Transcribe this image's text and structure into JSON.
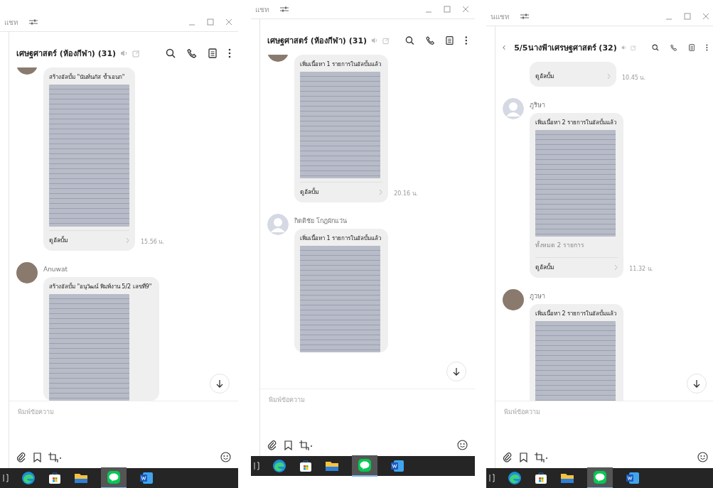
{
  "panels": [
    {
      "top_label": "แชท",
      "back_button": false,
      "title": "เศษฐศาสตร์ (ห้องกีฬา) (31)",
      "messages": [
        {
          "kind": "album",
          "avatar": {
            "kind": "photo"
          },
          "caption": "สร้างอัลบั้ม \"นันท์นภัส ข้ำเอนก\"",
          "link": "ดูอัลบั้ม",
          "time": "15.56 น."
        },
        {
          "kind": "album",
          "sender": "Anuwat",
          "avatar": {
            "kind": "photo"
          },
          "caption": "สร้างอัลบั้ม \"อนุวัฒน์ พิมพ์งาน 5/2 เลขที่9\""
        }
      ],
      "placeholder": "พิมพ์ข้อความ"
    },
    {
      "top_label": "แชท",
      "back_button": false,
      "title": "เศษฐศาสตร์ (ห้องกีฬา) (31)",
      "messages": [
        {
          "kind": "album",
          "avatar": {
            "kind": "photo"
          },
          "caption": "เพิ่มเนื้อหา 1 รายการในอัลบั้มแล้ว",
          "link": "ดูอัลบั้ม",
          "time": "20.16 น."
        },
        {
          "kind": "album",
          "sender": "กิตติชัย โกฎผักแว่น",
          "avatar": {
            "kind": "default"
          },
          "caption": "เพิ่มเนื้อหา 1 รายการในอัลบั้มแล้ว"
        }
      ],
      "placeholder": "พิมพ์ข้อความ"
    },
    {
      "top_label": "นแชท",
      "back_button": true,
      "title": "5/5นางฟ้าเศรษฐศาสตร์ (32)",
      "messages": [
        {
          "kind": "album_end",
          "link": "ดูอัลบั้ม",
          "time": "10.45 น."
        },
        {
          "kind": "album",
          "sender": "ภูริษา",
          "avatar": {
            "kind": "default"
          },
          "caption": "เพิ่มเนื้อหา 2 รายการในอัลบั้มแล้ว",
          "total": "ทั้งหมด 2 รายการ",
          "link": "ดูอัลบั้ม",
          "time": "11.32 น."
        },
        {
          "kind": "album",
          "sender": "ภูวษา",
          "avatar": {
            "kind": "photo"
          },
          "caption": "เพิ่มเนื้อหา 2 รายการในอัลบั้มแล้ว"
        }
      ],
      "placeholder": "พิมพ์ข้อความ"
    }
  ]
}
